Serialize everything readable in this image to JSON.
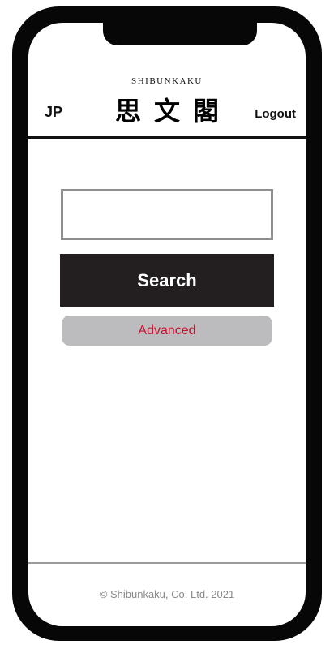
{
  "header": {
    "lang_toggle": "JP",
    "logo_sub": "SHIBUNKAKU",
    "logo_main": "思文閣",
    "logout_label": "Logout"
  },
  "search": {
    "input_value": "",
    "input_placeholder": "",
    "button_label": "Search",
    "advanced_label": "Advanced"
  },
  "footer": {
    "copyright": "© Shibunkaku, Co. Ltd. 2021"
  },
  "colors": {
    "frame": "#070707",
    "search_button_bg": "#231f20",
    "advanced_button_bg": "#bcbcbe",
    "advanced_text": "#c8102e",
    "input_border": "#8f8f8f"
  }
}
